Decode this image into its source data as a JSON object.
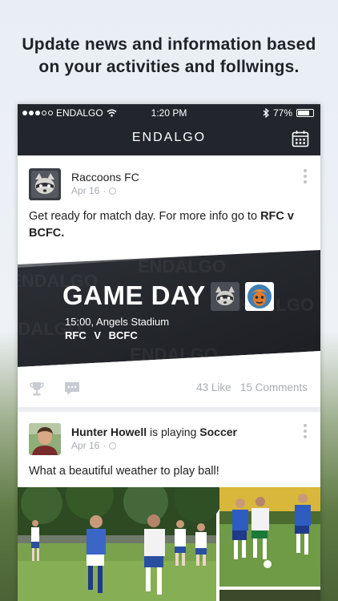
{
  "headline": {
    "line1": "Update news and information based",
    "line2": "on your activities and follwings."
  },
  "status_bar": {
    "carrier": "ENDALGO",
    "time": "1:20 PM",
    "battery": "77%",
    "battery_level": 0.77,
    "signal_bars": 3,
    "signal_total": 5
  },
  "nav": {
    "brand": "ENDALGO",
    "calendar_icon": "calendar-icon"
  },
  "posts": [
    {
      "author": "Raccoons FC",
      "date": "Apr 16",
      "separator": "·",
      "text_prefix": "Get ready for match day. For more info go to ",
      "text_link": "RFC v BCFC.",
      "banner": {
        "watermark": "ENDALGO",
        "title": "GAME DAY",
        "time_place": "15:00, Angels Stadium",
        "teams": "RFC V BCFC"
      },
      "likes": "43 Like",
      "comments": "15 Comments"
    },
    {
      "author": "Hunter Howell",
      "activity_connector": "is playing",
      "activity": "Soccer",
      "date": "Apr 16",
      "separator": "·",
      "text": "What a beautiful weather to play ball!"
    }
  ],
  "colors": {
    "dark_bar": "#22252b",
    "text": "#222222",
    "muted": "#a8adb3",
    "card_bg": "#ffffff"
  }
}
